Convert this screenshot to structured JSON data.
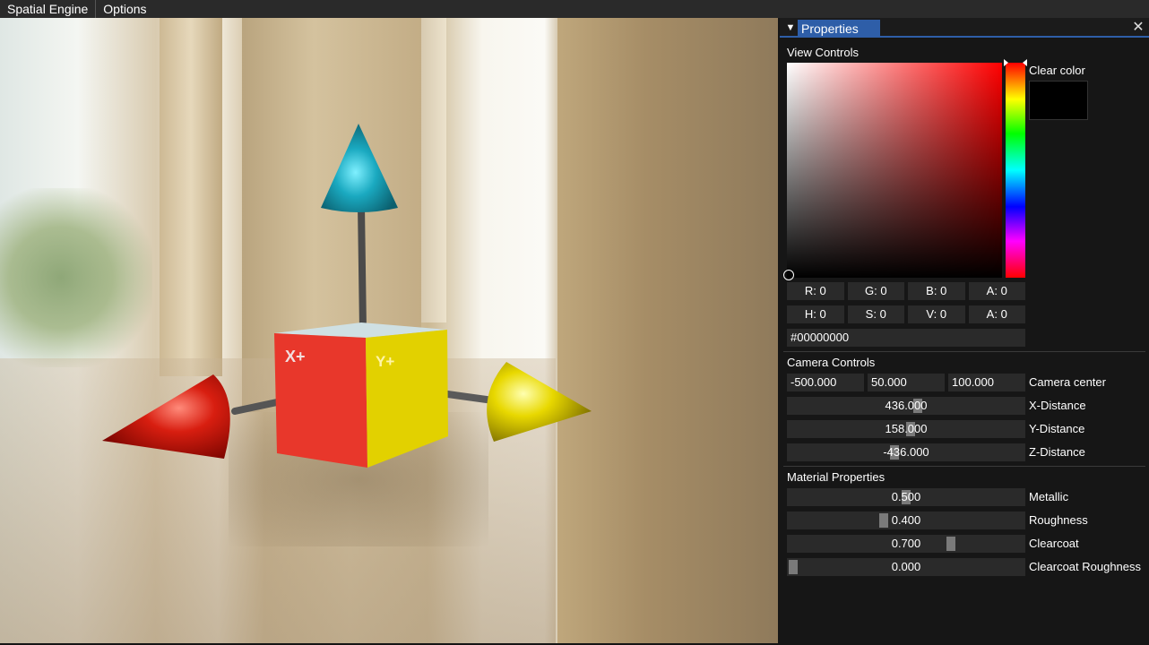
{
  "menubar": {
    "items": [
      "Spatial Engine",
      "Options"
    ]
  },
  "viewport": {
    "cube_face_x": "X+",
    "cube_face_y": "Y+"
  },
  "panel": {
    "title": "Properties",
    "view_controls": {
      "heading": "View Controls",
      "clear_color_label": "Clear color",
      "clear_color": "#000000",
      "rgba": [
        {
          "label": "R:",
          "value": "0"
        },
        {
          "label": "G:",
          "value": "0"
        },
        {
          "label": "B:",
          "value": "0"
        },
        {
          "label": "A:",
          "value": "0"
        }
      ],
      "hsva": [
        {
          "label": "H:",
          "value": "0"
        },
        {
          "label": "S:",
          "value": "0"
        },
        {
          "label": "V:",
          "value": "0"
        },
        {
          "label": "A:",
          "value": "0"
        }
      ],
      "hex": "#00000000"
    },
    "camera_controls": {
      "heading": "Camera Controls",
      "center": {
        "x": "-500.000",
        "y": "50.000",
        "z": "100.000",
        "label": "Camera center"
      },
      "x_distance": {
        "value": "436.000",
        "label": "X-Distance",
        "fraction": 0.55
      },
      "y_distance": {
        "value": "158.000",
        "label": "Y-Distance",
        "fraction": 0.52
      },
      "z_distance": {
        "value": "-436.000",
        "label": "Z-Distance",
        "fraction": 0.45
      }
    },
    "material_properties": {
      "heading": "Material Properties",
      "metallic": {
        "value": "0.500",
        "label": "Metallic",
        "fraction": 0.5
      },
      "roughness": {
        "value": "0.400",
        "label": "Roughness",
        "fraction": 0.4
      },
      "clearcoat": {
        "value": "0.700",
        "label": "Clearcoat",
        "fraction": 0.7
      },
      "clearcoat_roughness": {
        "value": "0.000",
        "label": "Clearcoat Roughness",
        "fraction": 0.0
      }
    }
  }
}
